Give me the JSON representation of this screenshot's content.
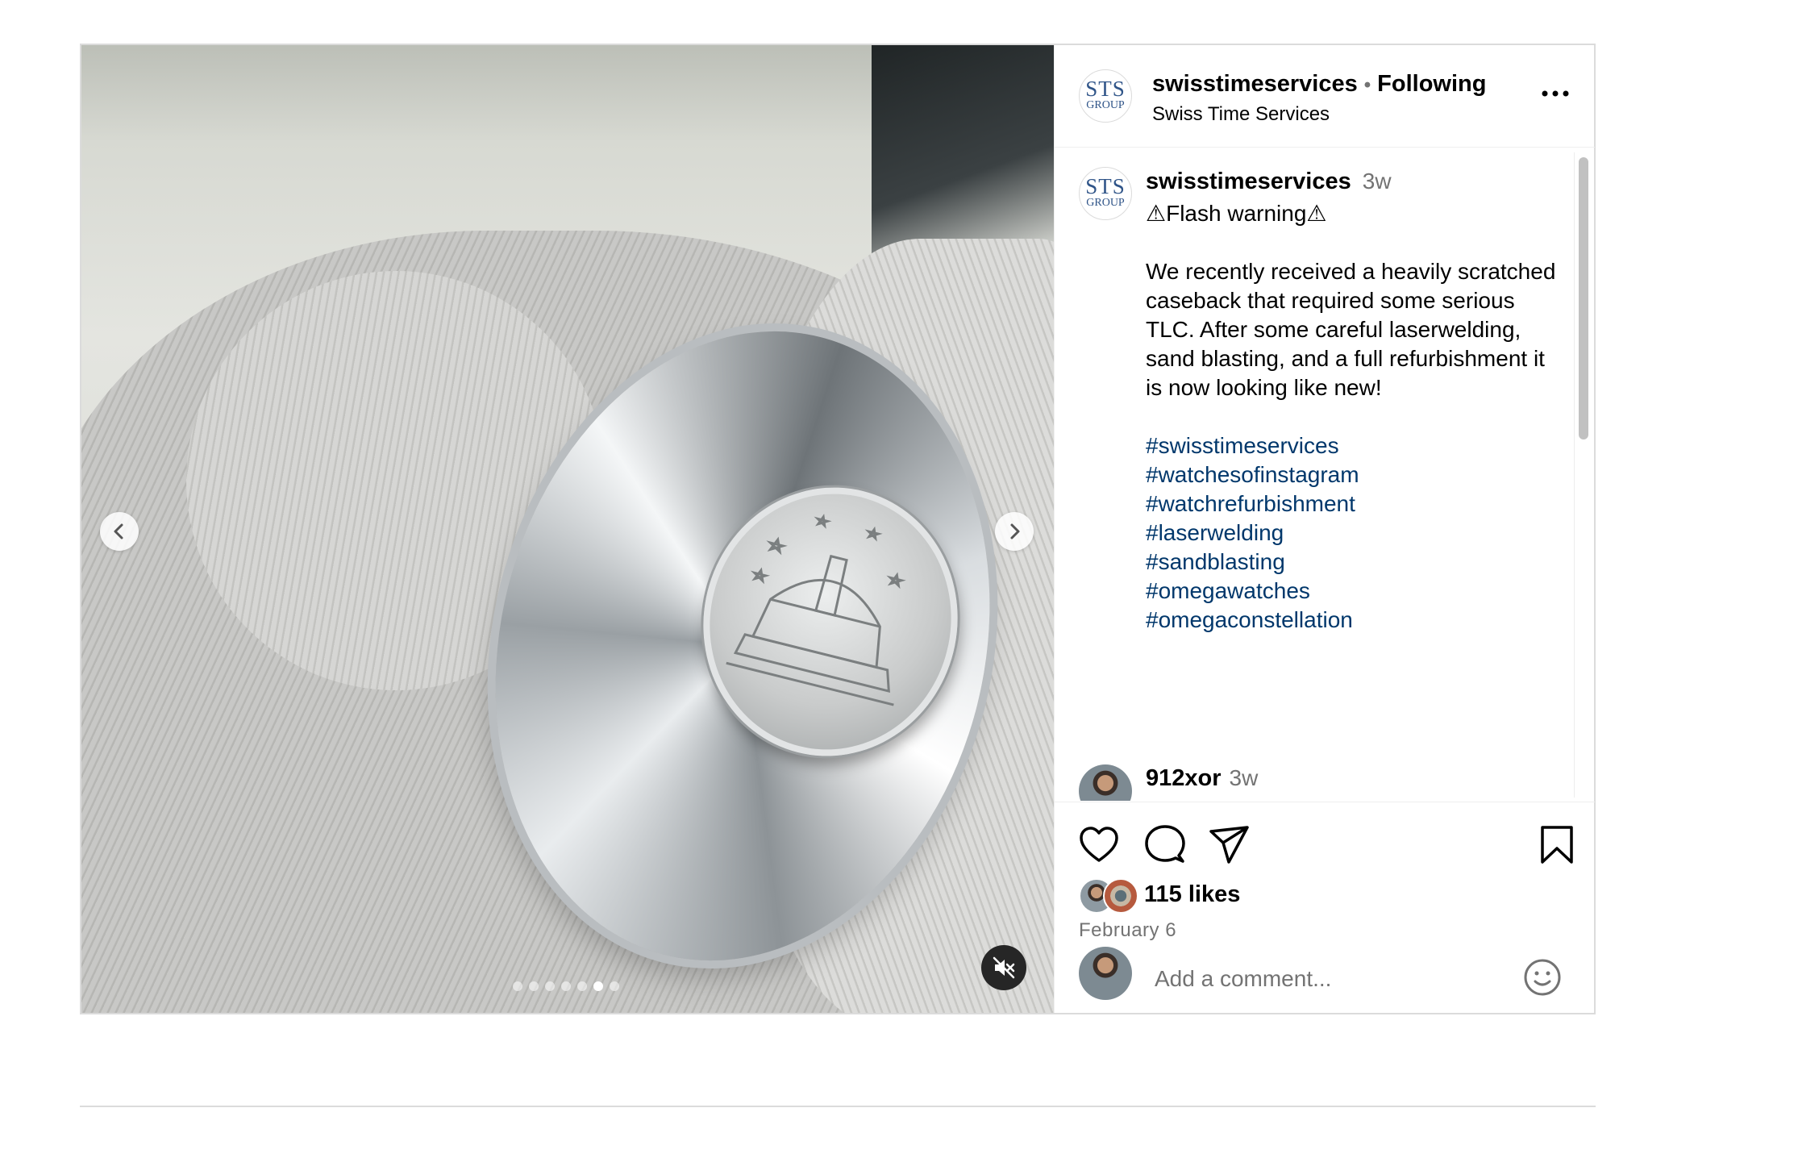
{
  "post": {
    "media": {
      "carousel": {
        "count": 7,
        "active_index": 5
      },
      "muted": true
    },
    "header": {
      "username": "swisstimeservices",
      "separator": "•",
      "follow_status": "Following",
      "subtitle": "Swiss Time Services",
      "avatar": {
        "line1": "STS",
        "line2": "GROUP"
      }
    },
    "caption": {
      "username": "swisstimeservices",
      "time": "3w",
      "warning": "⚠Flash warning⚠",
      "body": "We recently received a heavily scratched caseback that required some serious TLC. After some careful laserwelding, sand blasting, and a full refurbishment it is now looking like new!",
      "hashtags": [
        "#swisstimeservices",
        "#watchesofinstagram",
        "#watchrefurbishment",
        "#laserwelding",
        "#sandblasting",
        "#omegawatches",
        "#omegaconstellation"
      ]
    },
    "comment_preview": {
      "username": "912xor",
      "time": "3w"
    },
    "engagement": {
      "likes": "115 likes",
      "date": "February 6"
    },
    "comment_box": {
      "placeholder": "Add a comment..."
    },
    "colors": {
      "hashtag": "#00376b",
      "secondary_text": "#737373",
      "brand_blue": "#2f5488"
    }
  }
}
